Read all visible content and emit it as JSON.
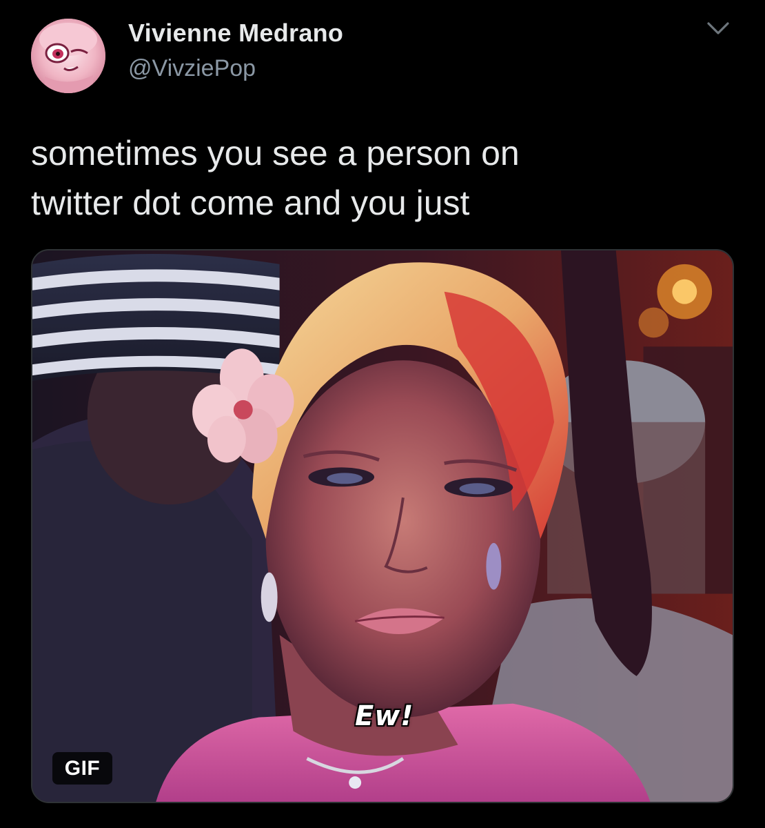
{
  "tweet": {
    "author": {
      "display_name": "Vivienne Medrano",
      "handle": "@VivziePop",
      "avatar_icon": "avatar-image"
    },
    "menu_icon": "chevron-down-icon",
    "text_lines": [
      "sometimes you see a person on",
      "twitter dot come and you just"
    ],
    "media": {
      "subtitle": "Ew!",
      "badge": "GIF"
    }
  },
  "colors": {
    "background": "#000000",
    "primary_text": "#e7e9ea",
    "secondary_text": "#8b98a5",
    "border": "#2f3336"
  }
}
